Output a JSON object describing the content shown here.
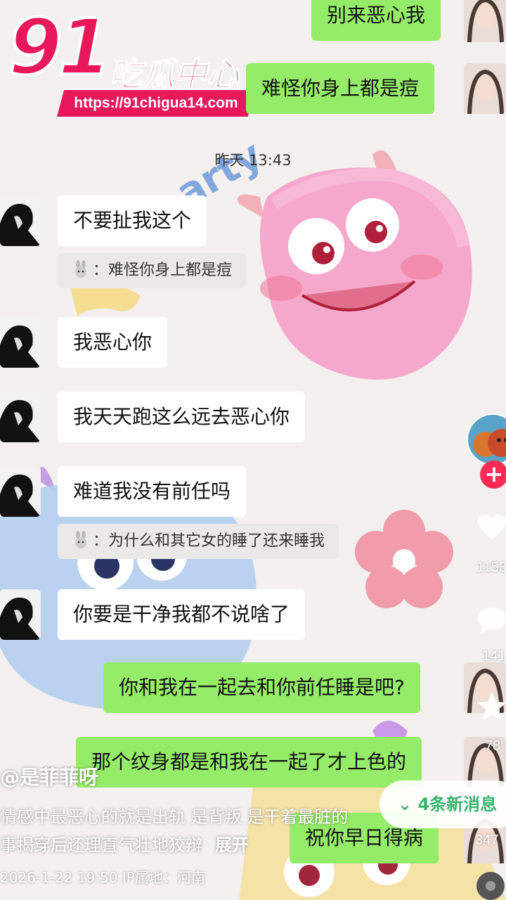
{
  "logo": {
    "number": "91",
    "name": "吃瓜中心",
    "url": "https://91chigua14.com"
  },
  "time_separator": "昨天 13:43",
  "messages": {
    "m0": "别来恶心我",
    "m1": "难怪你身上都是痘",
    "m2": "不要扯我这个",
    "q2": "：难怪你身上都是痘",
    "m3": "我恶心你",
    "m4": "我天天跑这么远去恶心你",
    "m5": "难道我没有前任吗",
    "q5": "：为什么和其它女的睡了还来睡我",
    "m6": "你要是干净我都不说啥了",
    "m7": "你和我在一起去和你前任睡是吧?",
    "m8": "那个纹身都是和我在一起了才上色的",
    "m9": "祝你早日得病"
  },
  "side": {
    "like_count": "1153",
    "comment_count": "141",
    "favorite_count": "78",
    "share_count": "347"
  },
  "post": {
    "author": "@是菲菲呀",
    "desc_line1": "情感中最恶心的就是出轨 是背叛 是干着最脏的",
    "desc_line2": "事揭穿后还理直气壮地狡辩",
    "expand": "展开",
    "meta": "2026-1-22 19:50  IP属地：河南"
  },
  "new_comments": "4条新消息",
  "colors": {
    "brand": "#e9185b",
    "wechat_green": "#95ec69",
    "douyin_red": "#fe2c55"
  }
}
